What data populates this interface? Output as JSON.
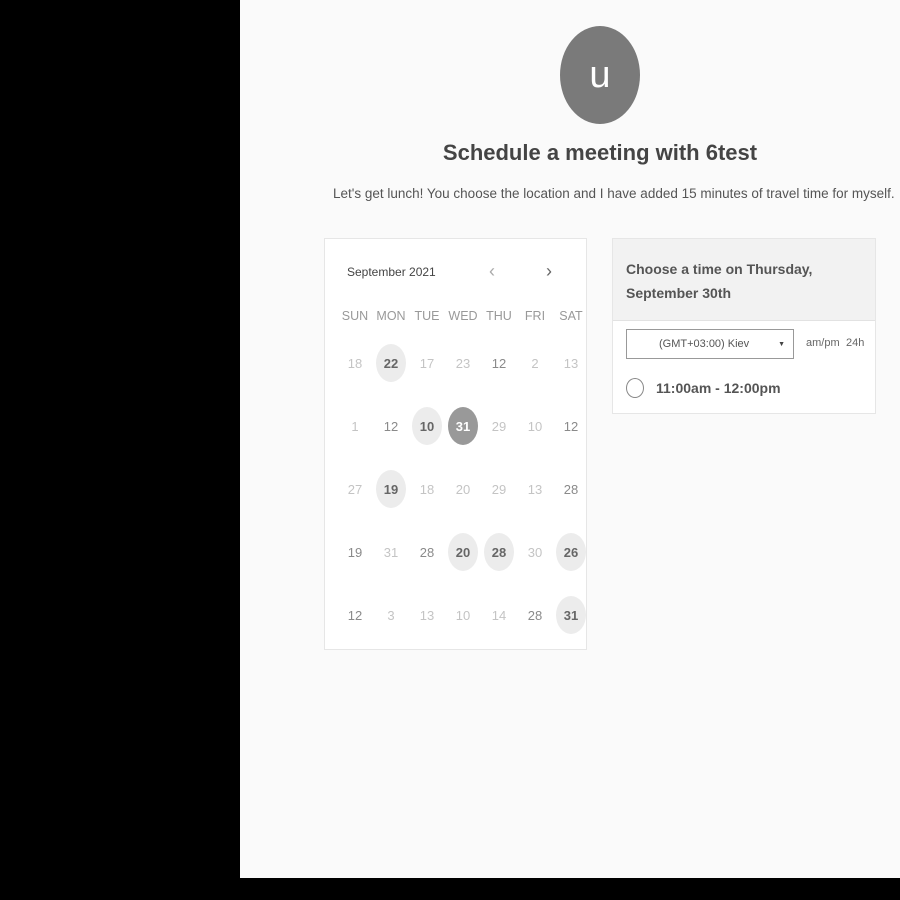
{
  "host": {
    "avatar_initial": "u",
    "title": "Schedule a meeting with 6test",
    "description": "Let's get lunch! You choose the location and I have added 15 minutes of travel time for myself."
  },
  "calendar": {
    "month_label": "September 2021",
    "prev_icon": "‹",
    "next_icon": "›",
    "weekdays": [
      "SUN",
      "MON",
      "TUE",
      "WED",
      "THU",
      "FRI",
      "SAT"
    ],
    "weeks": [
      [
        {
          "d": "18",
          "s": "faint"
        },
        {
          "d": "22",
          "s": "avail"
        },
        {
          "d": "17",
          "s": "faint"
        },
        {
          "d": "23",
          "s": "faint"
        },
        {
          "d": "12",
          "s": "normal"
        },
        {
          "d": "2",
          "s": "faint"
        },
        {
          "d": "13",
          "s": "faint"
        }
      ],
      [
        {
          "d": "1",
          "s": "faint"
        },
        {
          "d": "12",
          "s": "normal"
        },
        {
          "d": "10",
          "s": "avail"
        },
        {
          "d": "31",
          "s": "selected"
        },
        {
          "d": "29",
          "s": "faint"
        },
        {
          "d": "10",
          "s": "faint"
        },
        {
          "d": "12",
          "s": "normal"
        }
      ],
      [
        {
          "d": "27",
          "s": "faint"
        },
        {
          "d": "19",
          "s": "avail"
        },
        {
          "d": "18",
          "s": "faint"
        },
        {
          "d": "20",
          "s": "faint"
        },
        {
          "d": "29",
          "s": "faint"
        },
        {
          "d": "13",
          "s": "faint"
        },
        {
          "d": "28",
          "s": "normal"
        }
      ],
      [
        {
          "d": "19",
          "s": "normal"
        },
        {
          "d": "31",
          "s": "faint"
        },
        {
          "d": "28",
          "s": "normal"
        },
        {
          "d": "20",
          "s": "avail"
        },
        {
          "d": "28",
          "s": "avail"
        },
        {
          "d": "30",
          "s": "faint"
        },
        {
          "d": "26",
          "s": "avail"
        }
      ],
      [
        {
          "d": "12",
          "s": "normal"
        },
        {
          "d": "3",
          "s": "faint"
        },
        {
          "d": "13",
          "s": "faint"
        },
        {
          "d": "10",
          "s": "faint"
        },
        {
          "d": "14",
          "s": "faint"
        },
        {
          "d": "28",
          "s": "normal"
        },
        {
          "d": "31",
          "s": "avail"
        }
      ]
    ]
  },
  "times": {
    "heading": "Choose a time on Thursday, September 30th",
    "timezone": "(GMT+03:00) Kiev",
    "timezone_arrow": "▼",
    "format_ampm": "am/pm",
    "format_24h": "24h",
    "slots": [
      {
        "label": "11:00am - 12:00pm"
      }
    ]
  }
}
